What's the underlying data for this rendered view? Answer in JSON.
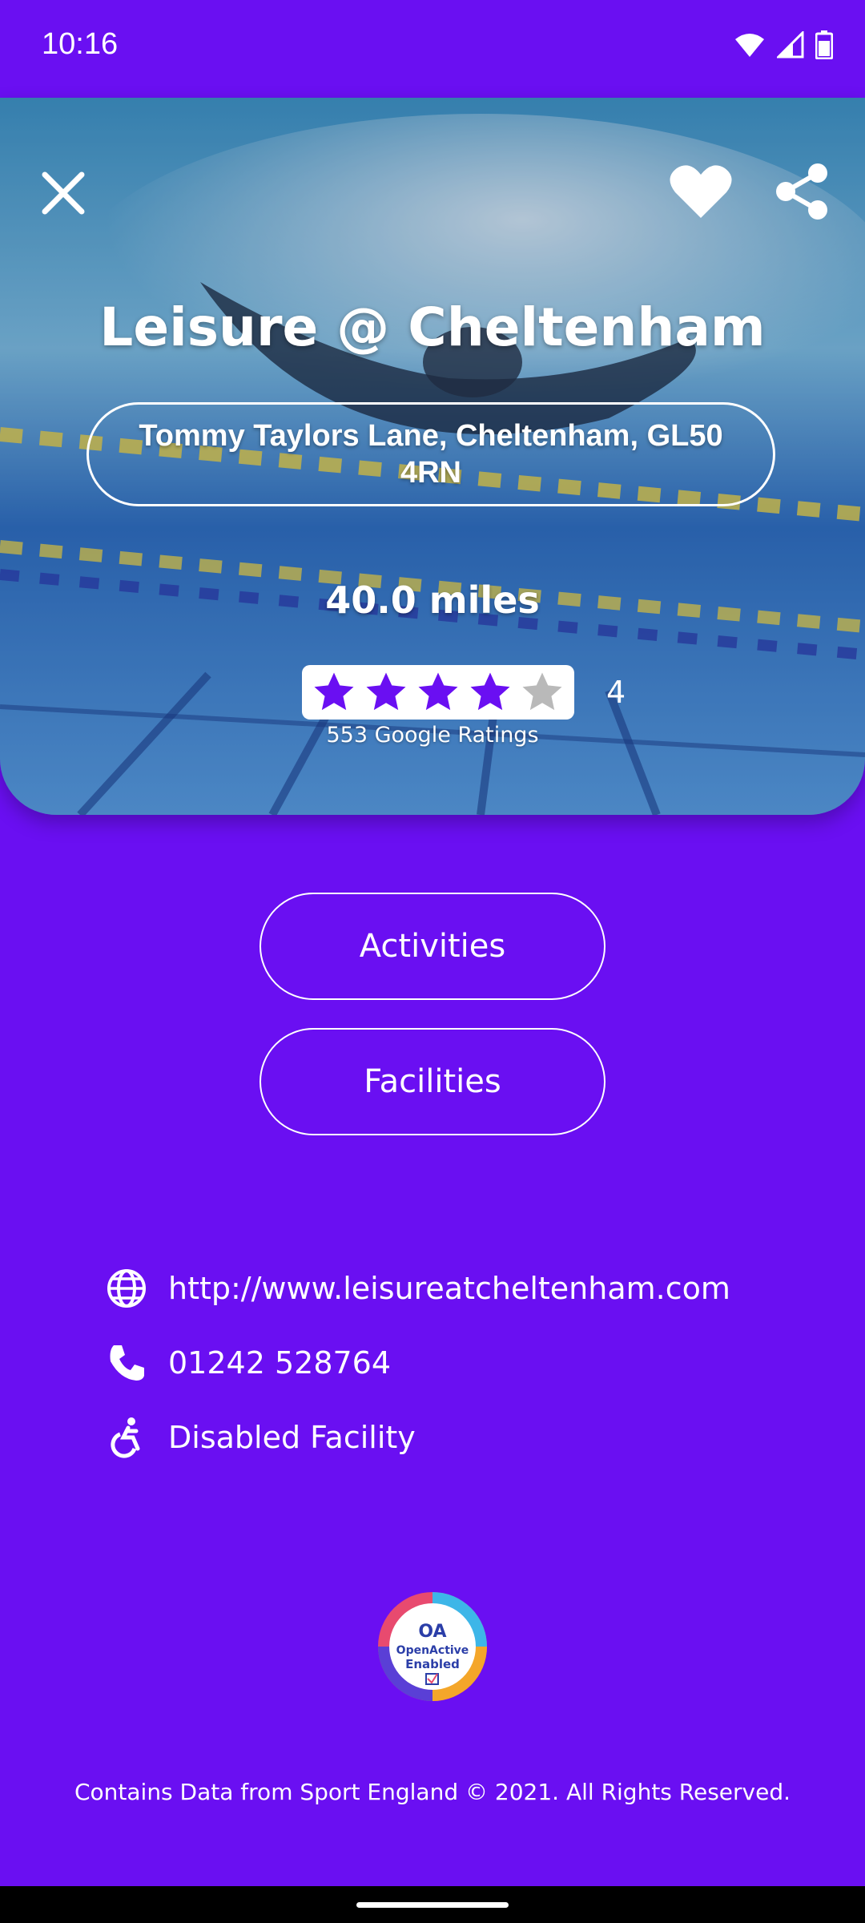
{
  "status_bar": {
    "time": "10:16",
    "icons": [
      "wifi-icon",
      "cell-signal-icon",
      "battery-icon"
    ]
  },
  "venue": {
    "name": "Leisure @ Cheltenham",
    "address": "Tommy Taylors Lane, Cheltenham, GL50 4RN",
    "distance": "40.0 miles",
    "rating": {
      "stars_filled": 4,
      "stars_total": 5,
      "value": "4",
      "count_label": "553 Google Ratings"
    }
  },
  "actions": {
    "activities_label": "Activities",
    "facilities_label": "Facilities"
  },
  "details": {
    "website": "http://www.leisureatcheltenham.com",
    "phone": "01242 528764",
    "accessibility": "Disabled Facility"
  },
  "badge": {
    "line1": "OpenActive",
    "line2": "Enabled"
  },
  "footer": "Contains Data from Sport England © 2021. All Rights Reserved.",
  "colors": {
    "brand_purple": "#6a0ff2",
    "star_filled": "#6a0ff2",
    "star_empty": "#b9b9b9"
  }
}
